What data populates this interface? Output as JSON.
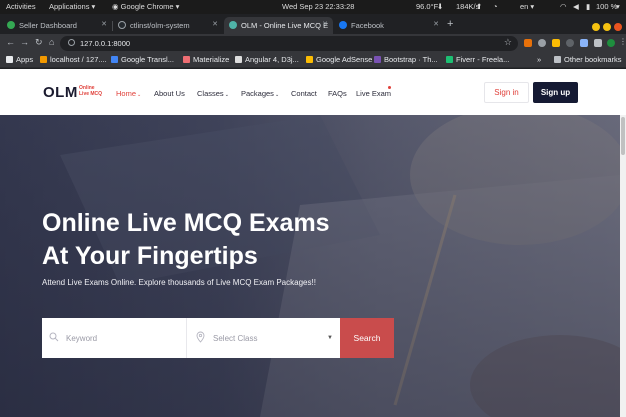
{
  "os_bar": {
    "activities": "Activities",
    "applications": "Applications",
    "app_name": "Google Chrome",
    "clock": "Wed Sep 23  22:33:28",
    "battery_temp": "96.0°F",
    "net_speed": "184K/s",
    "language": "en",
    "battery": "100 %"
  },
  "browser": {
    "tabs": [
      {
        "title": "Seller Dashboard",
        "color": "#34a853"
      },
      {
        "title": "ctlinst/olm-system",
        "color": "#24292e"
      },
      {
        "title": "OLM - Online Live MCQ E",
        "color": "#4fb3a8"
      },
      {
        "title": "Facebook",
        "color": "#1877f2"
      }
    ],
    "url": "127.0.0.1:8000",
    "bookmarks": [
      {
        "label": "Apps",
        "color": "#e8eaed"
      },
      {
        "label": "localhost / 127....",
        "color": "#f29900"
      },
      {
        "label": "Google Transl...",
        "color": "#4285f4"
      },
      {
        "label": "Materialize",
        "color": "#ee6e73"
      },
      {
        "label": "Angular 4, D3j...",
        "color": "#dddddd"
      },
      {
        "label": "Google AdSense",
        "color": "#fbbc04"
      },
      {
        "label": "Bootstrap · Th...",
        "color": "#7952b3"
      },
      {
        "label": "Fiverr - Freela...",
        "color": "#1dbf73"
      }
    ],
    "other_bookmarks": "Other bookmarks"
  },
  "site": {
    "logo": "OLM",
    "logo_sub_1": "Online",
    "logo_sub_2": "Live MCQ",
    "nav": {
      "home": "Home",
      "about": "About Us",
      "classes": "Classes",
      "packages": "Packages",
      "contact": "Contact",
      "faqs": "FAQs",
      "live_exam": "Live Exam"
    },
    "signin": "Sign in",
    "signup": "Sign up",
    "accent_color": "#e0403a",
    "dark_color": "#151a33"
  },
  "hero": {
    "title_line1": "Online Live MCQ Exams",
    "title_line2": "At Your Fingertips",
    "subtitle": "Attend Live Exams Online. Explore thousands of Live MCQ Exam Packages!!",
    "keyword_placeholder": "Keyword",
    "select_class": "Select Class",
    "search_button": "Search",
    "search_color": "#c94c4c"
  }
}
